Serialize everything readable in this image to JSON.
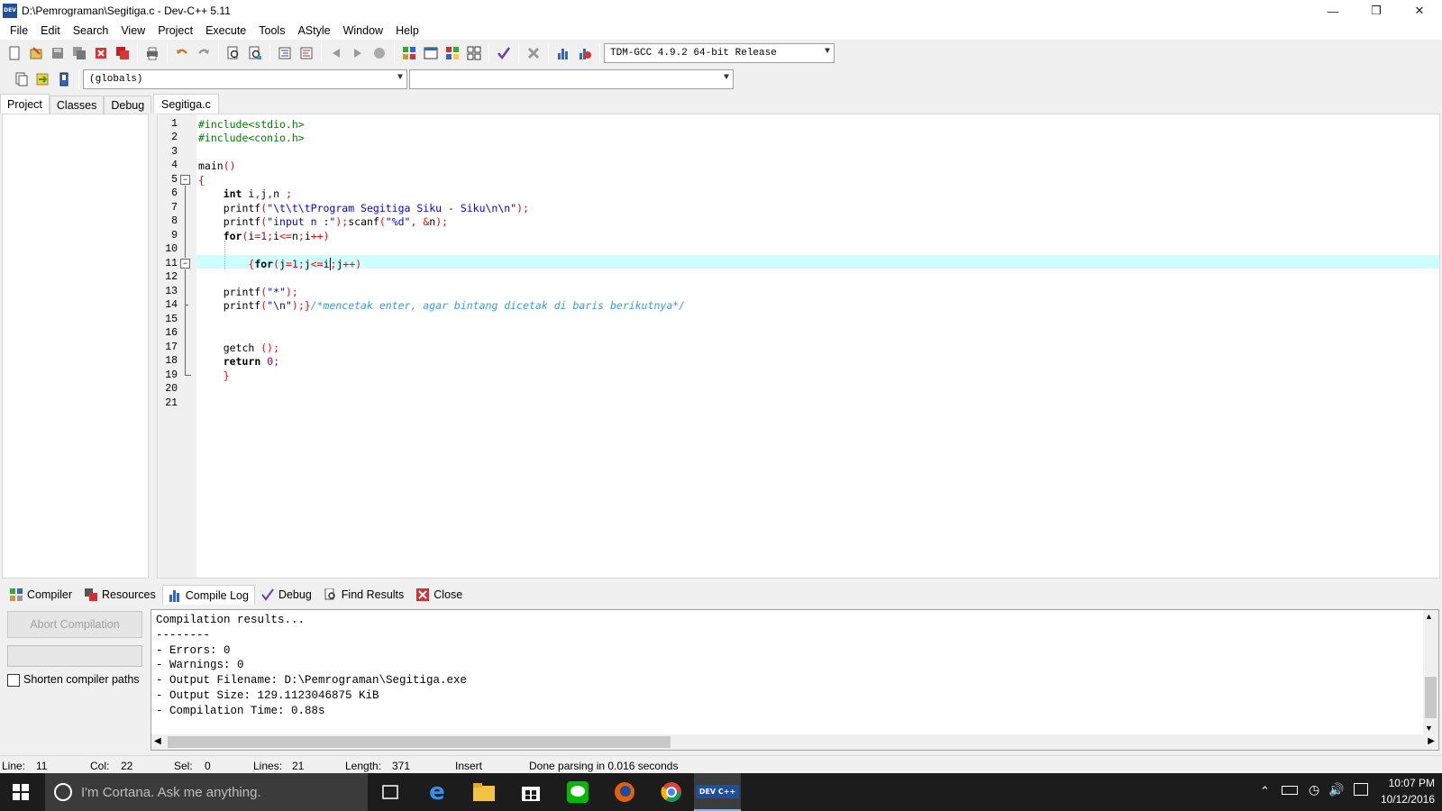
{
  "window": {
    "title": "D:\\Pemrograman\\Segitiga.c - Dev-C++ 5.11",
    "minimize": "—",
    "maximize": "❐",
    "close": "✕"
  },
  "menu": [
    "File",
    "Edit",
    "Search",
    "View",
    "Project",
    "Execute",
    "Tools",
    "AStyle",
    "Window",
    "Help"
  ],
  "toolbar": {
    "compiler_select": "TDM-GCC 4.9.2 64-bit Release",
    "scope_select": "(globals)",
    "member_select": ""
  },
  "left_tabs": [
    "Project",
    "Classes",
    "Debug"
  ],
  "editor": {
    "file_tab": "Segitiga.c",
    "line_numbers": [
      "1",
      "2",
      "3",
      "4",
      "5",
      "6",
      "7",
      "8",
      "9",
      "10",
      "11",
      "12",
      "13",
      "14",
      "15",
      "16",
      "17",
      "18",
      "19",
      "20",
      "21"
    ],
    "current_line": 11
  },
  "bottom_tabs": [
    "Compiler",
    "Resources",
    "Compile Log",
    "Debug",
    "Find Results",
    "Close"
  ],
  "compile_panel": {
    "abort_label": "Abort Compilation",
    "shorten_label": "Shorten compiler paths",
    "log": [
      "Compilation results...",
      "--------",
      "- Errors: 0",
      "- Warnings: 0",
      "- Output Filename: D:\\Pemrograman\\Segitiga.exe",
      "- Output Size: 129.1123046875 KiB",
      "- Compilation Time: 0.88s"
    ]
  },
  "status": {
    "line_label": "Line:",
    "line_value": "11",
    "col_label": "Col:",
    "col_value": "22",
    "sel_label": "Sel:",
    "sel_value": "0",
    "lines_label": "Lines:",
    "lines_value": "21",
    "length_label": "Length:",
    "length_value": "371",
    "mode": "Insert",
    "message": "Done parsing in 0.016 seconds"
  },
  "taskbar": {
    "cortana_placeholder": "I'm Cortana. Ask me anything.",
    "time": "10:07 PM",
    "date": "10/12/2016",
    "devcpp_label": "DEV C++"
  }
}
